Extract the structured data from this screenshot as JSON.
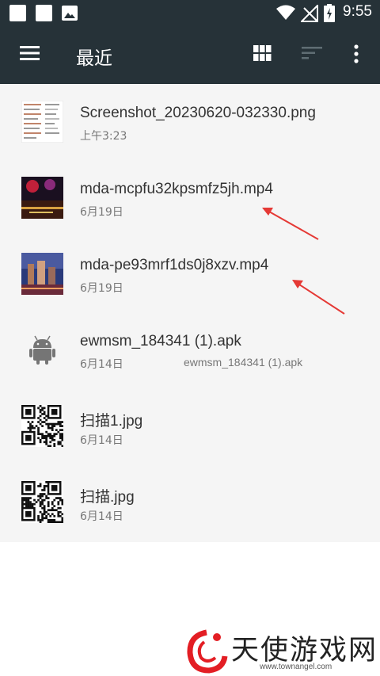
{
  "status_bar": {
    "time": "9:55"
  },
  "toolbar": {
    "title": "最近"
  },
  "files": [
    {
      "name": "Screenshot_20230620-032330.png",
      "date": "上午3:23",
      "extra": ""
    },
    {
      "name": "mda-mcpfu32kpsmfz5jh.mp4",
      "date": "6月19日",
      "extra": ""
    },
    {
      "name": "mda-pe93mrf1ds0j8xzv.mp4",
      "date": "6月19日",
      "extra": ""
    },
    {
      "name": "ewmsm_184341 (1).apk",
      "date": "6月14日",
      "extra": "ewmsm_184341 (1).apk"
    },
    {
      "name": "扫描1.jpg",
      "date": "6月14日",
      "extra": ""
    },
    {
      "name": "扫描.jpg",
      "date": "6月14日",
      "extra": ""
    }
  ],
  "watermark": {
    "text": "天使游戏网",
    "url": "www.townangel.com"
  },
  "colors": {
    "bar": "#263238",
    "list_bg": "#f5f5f5",
    "arrow": "#e53935"
  }
}
